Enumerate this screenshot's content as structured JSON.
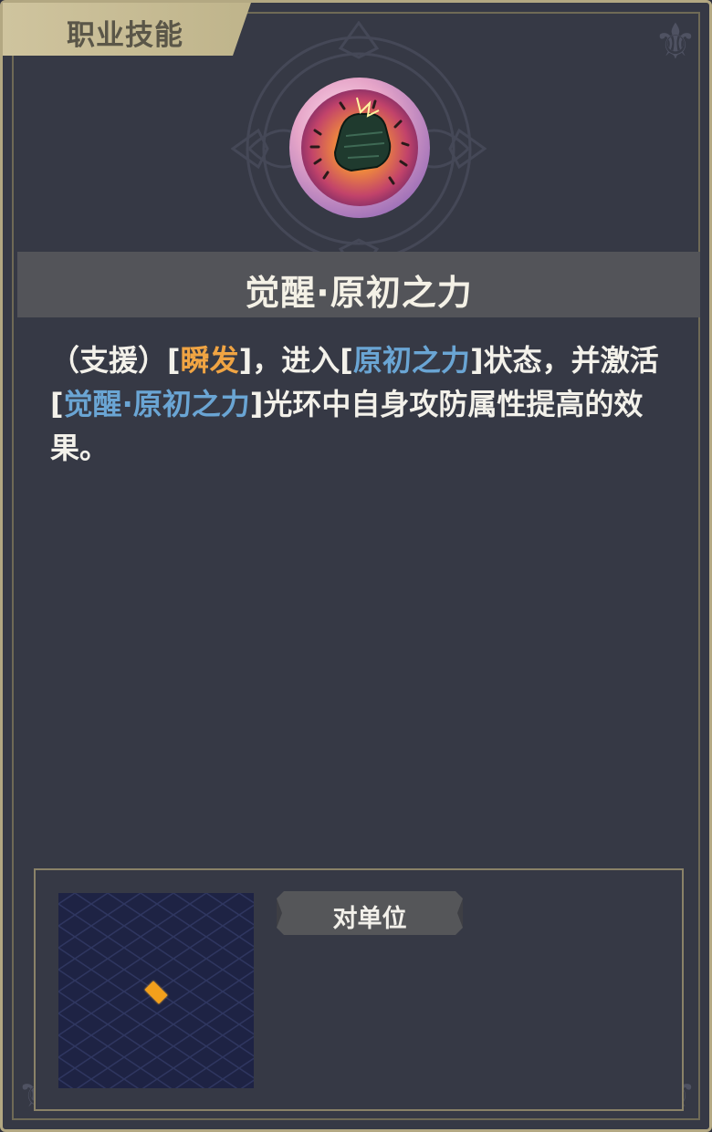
{
  "tab": {
    "label": "职业技能"
  },
  "skill": {
    "name": "觉醒·原初之力",
    "icon": "fist-rune-medallion"
  },
  "description": {
    "segments": [
      {
        "text": "（支援）[",
        "style": "plain"
      },
      {
        "text": "瞬发",
        "style": "orange"
      },
      {
        "text": "]，进入[",
        "style": "plain"
      },
      {
        "text": "原初之力",
        "style": "blue"
      },
      {
        "text": "]状态，并激活[",
        "style": "plain"
      },
      {
        "text": "觉醒·原初之力",
        "style": "blue"
      },
      {
        "text": "]光环中自身攻防属性提高的效果。",
        "style": "plain"
      }
    ]
  },
  "range": {
    "target_label": "对单位",
    "marker_icon": "diamond-marker"
  },
  "colors": {
    "keyword_orange": "#f0a443",
    "keyword_blue": "#6aa5d4",
    "frame_gold": "#b3a882",
    "panel_bg": "#363945"
  }
}
